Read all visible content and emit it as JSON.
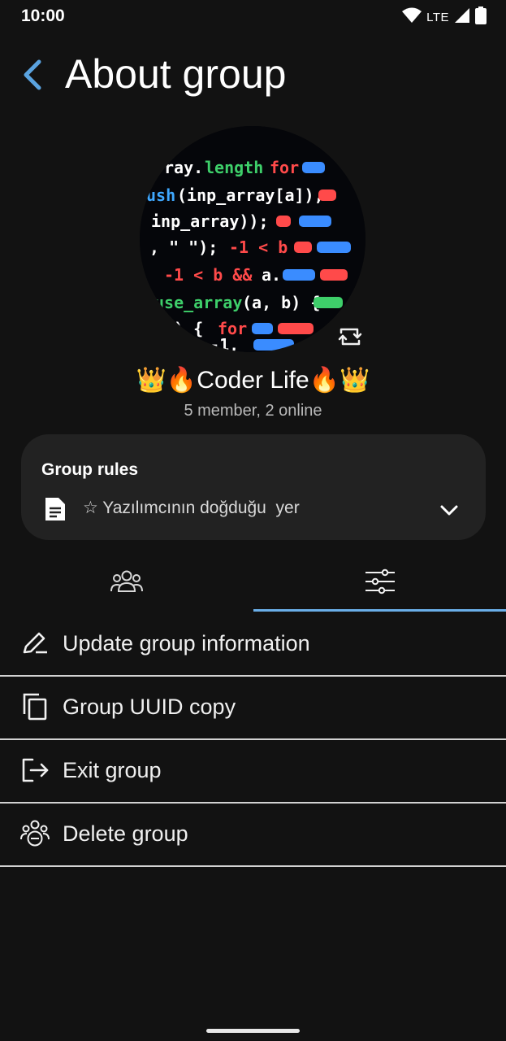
{
  "status_bar": {
    "time": "10:00",
    "network": "LTE",
    "wifi_icon": "wifi-icon",
    "signal_icon": "signal-icon",
    "battery_icon": "battery-icon"
  },
  "app_bar": {
    "back_icon": "back-arrow-icon",
    "title": "About group"
  },
  "group": {
    "avatar": "code-screen-avatar",
    "name": "👑🔥Coder Life🔥👑",
    "subtitle": "5 member, 2 online",
    "change_avatar_icon": "rotate-icon"
  },
  "rules": {
    "title": "Group rules",
    "text": "☆ Yazılımcının doğduğu  yer",
    "doc_icon": "document-icon",
    "expand_icon": "chevron-down-icon"
  },
  "tabs": [
    {
      "icon": "members-icon",
      "selected": false
    },
    {
      "icon": "settings-sliders-icon",
      "selected": true
    }
  ],
  "menu": [
    {
      "label": "Update group information",
      "icon": "edit-icon"
    },
    {
      "label": "Group UUID copy",
      "icon": "copy-icon"
    },
    {
      "label": "Exit group",
      "icon": "exit-icon"
    },
    {
      "label": "Delete group",
      "icon": "delete-group-icon"
    }
  ],
  "colors": {
    "background": "#121212",
    "card": "#222222",
    "accent": "#6aaee8",
    "divider": "#d2d2d2"
  }
}
